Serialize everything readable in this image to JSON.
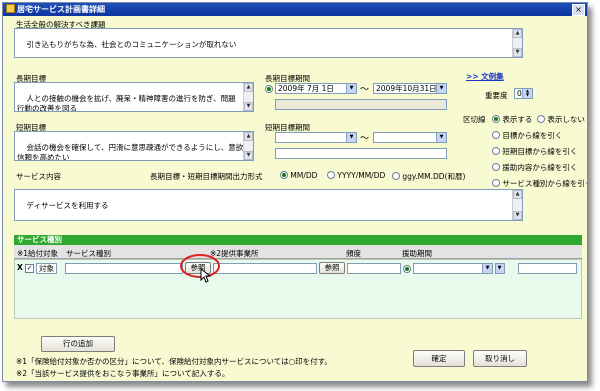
{
  "window": {
    "title": "居宅サービス計画書詳細",
    "close_label": "×"
  },
  "issue": {
    "label": "生活全般の解決すべき課題",
    "value": "引き込もりがちな為、社会とのコミュニケーションが取れない"
  },
  "long_goal": {
    "label": "長期目標",
    "value": "人との接触の機会を拡げ、廃呆・精神障害の進行を防ぎ、問題\n行動の改善を図る"
  },
  "long_period": {
    "label": "長期目標期間",
    "start": "2009年 7月 1日",
    "tilde": "〜",
    "end": "2009年10月31日"
  },
  "short_goal": {
    "label": "短期目標",
    "value": "会話の機会を確保して、円滑に意思疎通ができるようにし、意欲と\n信頼を高めたい"
  },
  "short_period": {
    "label": "短期目標期間",
    "tilde": "〜"
  },
  "format_row": {
    "label": "長期目標・短期目標期間出力形式",
    "options": [
      "MM/DD",
      "YYYY/MM/DD",
      "ggy.MM.DD(和暦)"
    ],
    "selected": 0
  },
  "service": {
    "label": "サービス内容",
    "value": "ディサービスを利用する"
  },
  "links": {
    "bunrei": ">> 文例集"
  },
  "priority": {
    "label": "重要度",
    "value": "0"
  },
  "divider": {
    "label": "区切線",
    "options": [
      "表示する",
      "表示しない"
    ],
    "selected": 0
  },
  "line_options": [
    "目標から線を引く",
    "短期目標から線を引く",
    "援助内容から線を引く",
    "サービス種別から線を引く"
  ],
  "table": {
    "header": "サービス種別",
    "col1": "※1給付対象",
    "col2": "サービス種別",
    "col3": "※2提供事業所",
    "col4": "頻度",
    "col5": "援助期間",
    "row_delete": "X",
    "row_check": "✓",
    "row_target": "対象",
    "ref_button_1": "参照",
    "ref_button_2": "参照"
  },
  "buttons": {
    "add_row": "行の追加",
    "confirm": "確定",
    "cancel": "取り消し"
  },
  "notes": [
    "※1「保険給付対象か否かの区分」について、保険給付対象内サービスについては○印を付す。",
    "※2「当該サービス提供をおこなう事業所」について記入する。"
  ],
  "colors": {
    "title_bar": "#0d34a0",
    "panel_bg": "#f8fbd2",
    "table_header": "#2fa82f",
    "highlight_circle": "#e02020"
  }
}
